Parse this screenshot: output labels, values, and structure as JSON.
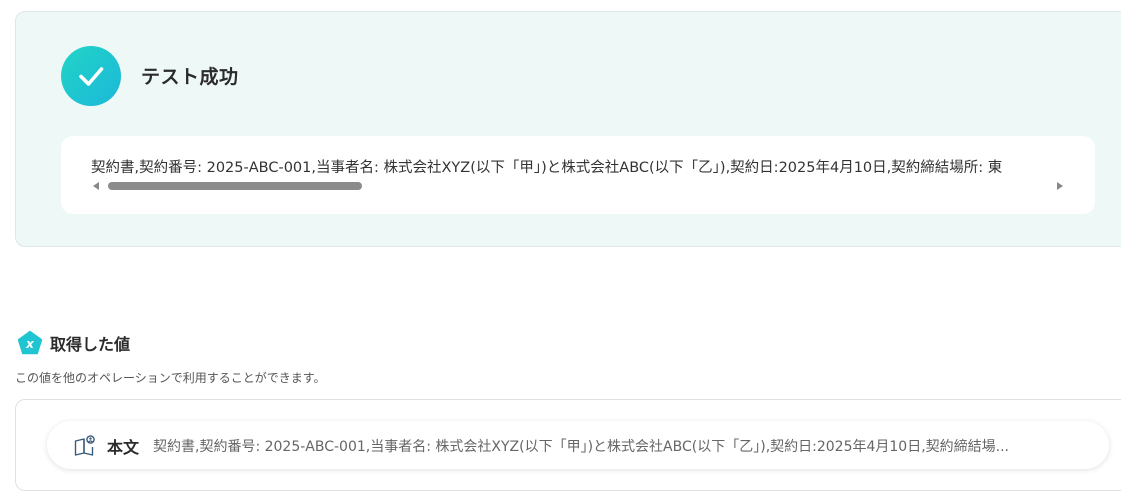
{
  "test_result": {
    "title": "テスト成功",
    "output_text": "契約書,契約番号: 2025-ABC-001,当事者名: 株式会社XYZ(以下「甲」)と株式会社ABC(以下「乙」),契約日:2025年4月10日,契約締結場所: 東"
  },
  "captured_values": {
    "title": "取得した値",
    "description": "この値を他のオペレーションで利用することができます。",
    "items": [
      {
        "label": "本文",
        "value": "契約書,契約番号: 2025-ABC-001,当事者名: 株式会社XYZ(以下「甲」)と株式会社ABC(以下「乙」),契約日:2025年4月10日,契約締結場..."
      }
    ]
  },
  "colors": {
    "accent": "#1fc5d0",
    "panel_bg": "#eef8f7"
  }
}
